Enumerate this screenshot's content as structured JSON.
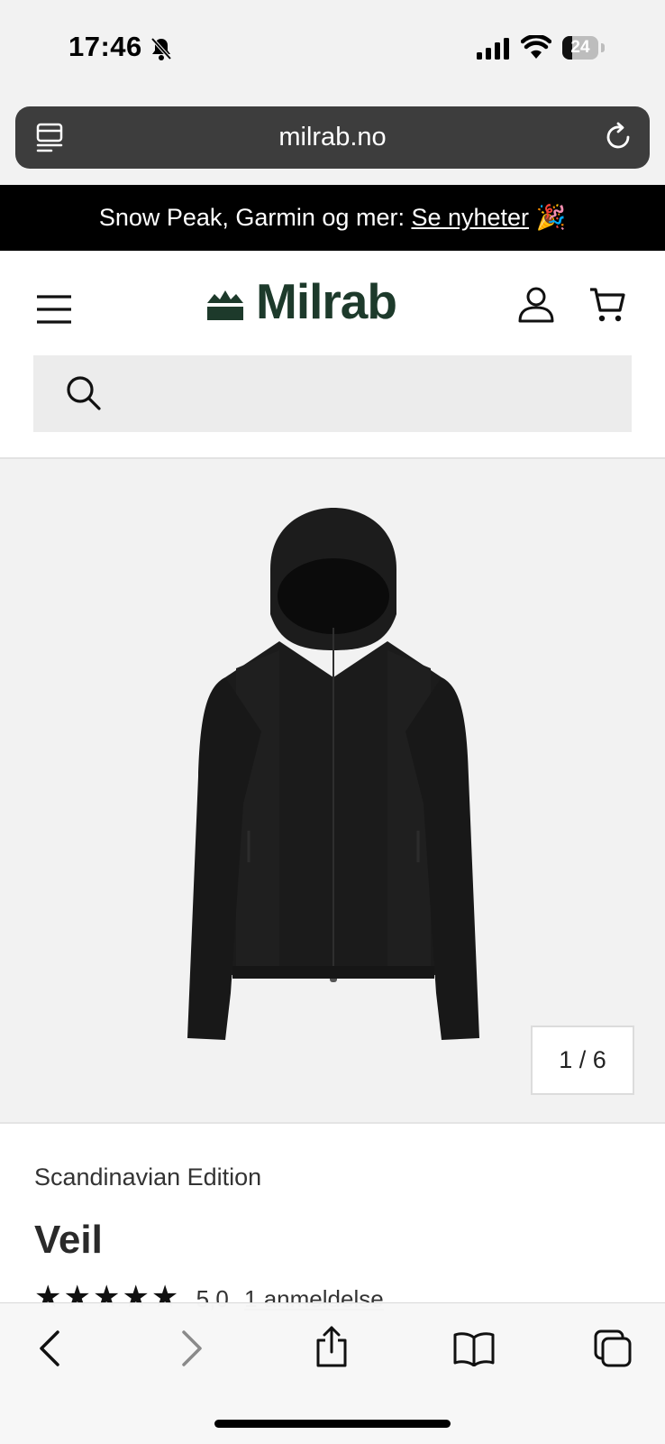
{
  "status_bar": {
    "time": "17:46",
    "battery": "24"
  },
  "browser": {
    "url": "milrab.no"
  },
  "announcement": {
    "text": "Snow Peak, Garmin og mer: ",
    "link": "Se nyheter",
    "emoji": "🎉"
  },
  "header": {
    "logo": "Milrab",
    "search_placeholder": ""
  },
  "gallery": {
    "counter": "1 / 6"
  },
  "product": {
    "brand": "Scandinavian Edition",
    "title": "Veil",
    "stars": "★★★★★",
    "rating_value": "5,0",
    "review_count": "1 anmeldelse"
  },
  "colors": {
    "brand_green": "#1d3a2b",
    "announcement_bg": "#000000"
  },
  "icons": [
    "bell-slash-icon",
    "signal-icon",
    "wifi-icon",
    "battery-icon",
    "tabs-icon",
    "reload-icon",
    "menu-icon",
    "logo-icon",
    "account-icon",
    "cart-icon",
    "search-icon",
    "back-icon",
    "forward-icon",
    "share-icon",
    "bookmarks-icon",
    "tabs-overview-icon"
  ]
}
